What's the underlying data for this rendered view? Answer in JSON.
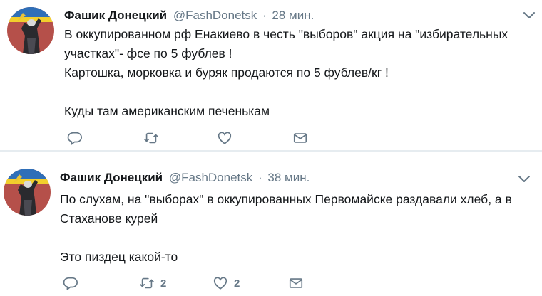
{
  "tweets": [
    {
      "author_name": "Фашик Донецкий",
      "author_handle": "@FashDonetsk",
      "dot": "·",
      "time": "28 мин.",
      "lines": [
        "В оккупированном рф Енакиево в честь \"выборов\" акция на \"избирательных участках\"- фсе по 5 фублев !",
        "Картошка, морковка и буряк продаются по 5 фублев/кг !",
        "Куды там американским печенькам"
      ],
      "retweet_count": "",
      "like_count": ""
    },
    {
      "author_name": "Фашик Донецкий",
      "author_handle": "@FashDonetsk",
      "dot": "·",
      "time": "38 мин.",
      "lines": [
        "По слухам, на \"выборах\" в оккупированных Первомайске раздавали хлеб, а в Стаханове курей",
        "Это пиздец какой-то"
      ],
      "retweet_count": "2",
      "like_count": "2"
    }
  ],
  "icons": {
    "reply": "reply-icon",
    "retweet": "retweet-icon",
    "like": "heart-icon",
    "dm": "envelope-icon",
    "caret": "chevron-down-icon",
    "avatar": "avatar"
  },
  "colors": {
    "icon_gray": "#657786",
    "text": "#14171a",
    "divider": "#e6ecf0"
  }
}
